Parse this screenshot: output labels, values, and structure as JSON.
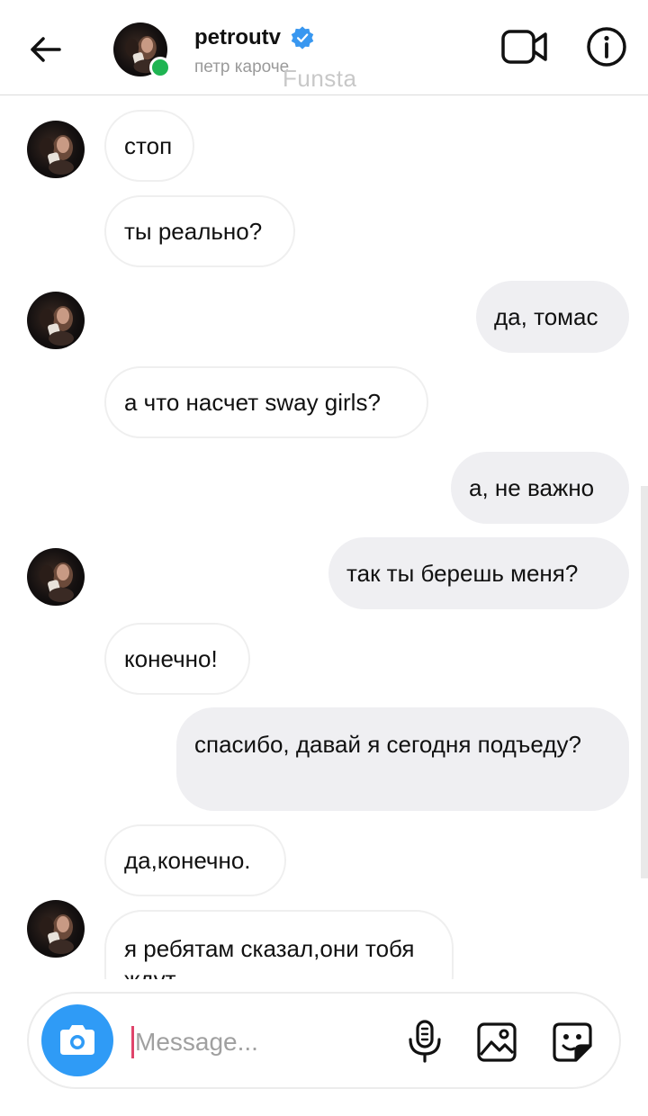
{
  "header": {
    "username": "petroutv",
    "full_name": "петр кароче",
    "watermark": "Funsta",
    "verified": true,
    "online": true,
    "colors": {
      "verified": "#3897f0",
      "online": "#1fb452"
    },
    "icons": [
      "back-arrow-icon",
      "verified-badge-icon",
      "video-call-icon",
      "info-icon"
    ]
  },
  "messages": [
    {
      "side": "in",
      "text": "стоп",
      "avatar": false
    },
    {
      "side": "in",
      "text": "ты реально?",
      "avatar": true
    },
    {
      "side": "out",
      "text": "да, томас"
    },
    {
      "side": "in",
      "text": "а что насчет sway girls?",
      "avatar": true
    },
    {
      "side": "out",
      "text": "а, не важно"
    },
    {
      "side": "out",
      "text": "так ты берешь меня?"
    },
    {
      "side": "in",
      "text": "конечно!",
      "avatar": true
    },
    {
      "side": "out",
      "text": "спасибо, давай я сегодня подъеду?"
    },
    {
      "side": "in",
      "text": "да,конечно.",
      "avatar": false
    },
    {
      "side": "in",
      "text": "я ребятам сказал,они тобя ждут",
      "avatar": true
    }
  ],
  "composer": {
    "placeholder": "Message...",
    "value": "",
    "colors": {
      "camera_button": "#2f9bf6",
      "caret": "#e0446a"
    },
    "icons": [
      "camera-icon",
      "microphone-icon",
      "gallery-icon",
      "sticker-icon"
    ]
  }
}
